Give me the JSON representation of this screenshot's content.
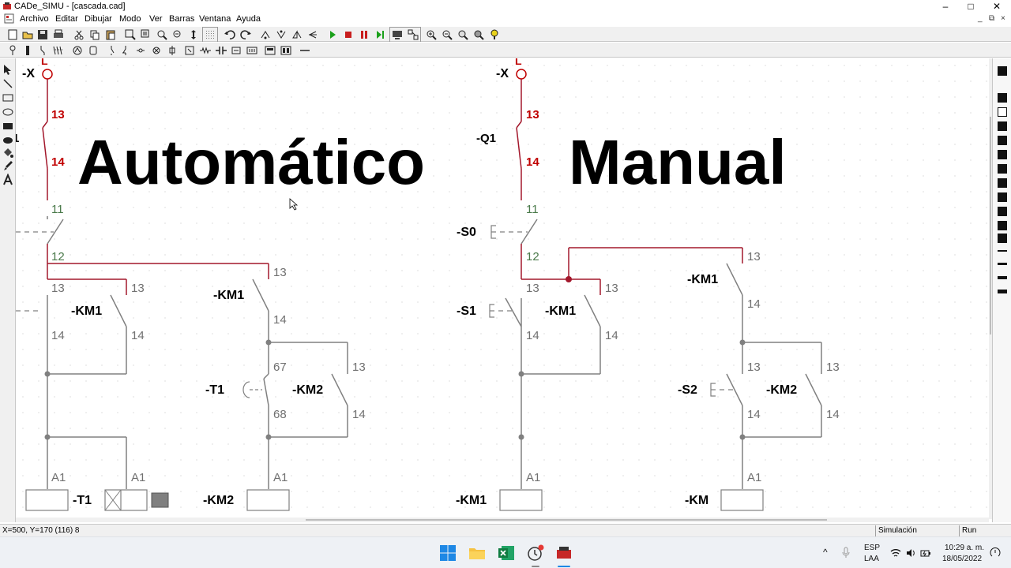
{
  "window": {
    "title": "CADe_SIMU - [cascada.cad]",
    "minimize_glyph": "–",
    "maximize_glyph": "□",
    "close_glyph": "✕"
  },
  "menu": {
    "items": [
      "Archivo",
      "Editar",
      "Dibujar",
      "Modo",
      "Ver",
      "Barras",
      "Ventana",
      "Ayuda"
    ],
    "mdi_minimize": "_",
    "mdi_restore": "⧉",
    "mdi_close": "×"
  },
  "headings": {
    "left": "Automático",
    "right": "Manual"
  },
  "labels": {
    "phase": "L",
    "x_terminal": "-X",
    "q1": "-Q1",
    "q1_partial": "1",
    "s0": "-S0",
    "s1": "-S1",
    "s2": "-S2",
    "km1": "-KM1",
    "km2": "-KM2",
    "t1": "-T1",
    "km": "-KM",
    "n11": "11",
    "n12": "12",
    "n13": "13",
    "n14": "14",
    "n67": "67",
    "n68": "68",
    "a1": "A1"
  },
  "colors": {
    "wire_red": "#a3182c",
    "terminal_red": "#c00000",
    "number_red": "#c00000",
    "number_green": "#4a7a4a",
    "number_gray": "#707070",
    "wire_gray": "#808080"
  },
  "status": {
    "coords": "X=500, Y=170 (116) 8",
    "mode": "Simulación",
    "state": "Run"
  },
  "taskbar": {
    "lang_top": "ESP",
    "lang_bottom": "LAA",
    "time": "10:29 a. m.",
    "date": "18/05/2022"
  },
  "icons": {
    "app": "cadesimu-icon",
    "start": "windows-start-icon",
    "explorer": "folder-icon",
    "excel": "excel-icon",
    "tools": "tools-icon",
    "cadesimu_task": "cadesimu-task-icon"
  }
}
